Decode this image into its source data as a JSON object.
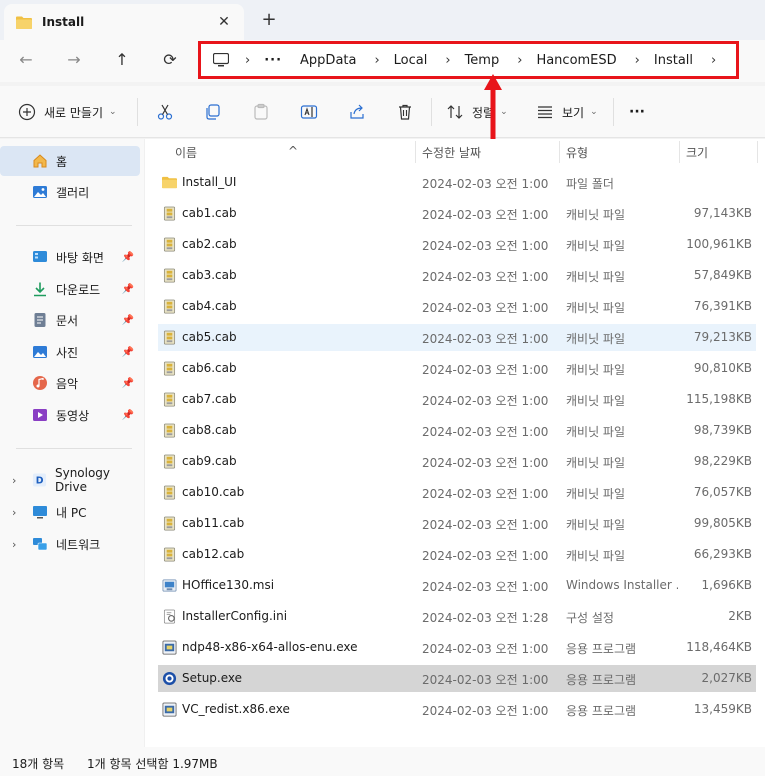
{
  "window": {
    "tab_title": "Install",
    "new_tab": "+",
    "close": "✕"
  },
  "nav": {
    "back": "←",
    "forward": "→",
    "up": "↑",
    "refresh": "⟳"
  },
  "breadcrumb": {
    "overflow": "···",
    "separator": "›",
    "items": [
      "AppData",
      "Local",
      "Temp",
      "HancomESD",
      "Install"
    ]
  },
  "toolbar": {
    "new_label": "새로 만들기",
    "sort_label": "정렬",
    "view_label": "보기",
    "more": "···"
  },
  "sidebar": {
    "home": "홈",
    "gallery": "갤러리",
    "quick": [
      "바탕 화면",
      "다운로드",
      "문서",
      "사진",
      "음악",
      "동영상"
    ],
    "synology": "Synology Drive",
    "this_pc": "내 PC",
    "network": "네트워크"
  },
  "columns": {
    "name": "이름",
    "date": "수정한 날짜",
    "type": "유형",
    "size": "크기"
  },
  "files": [
    {
      "name": "Install_UI",
      "date": "2024-02-03 오전 1:00",
      "type": "파일 폴더",
      "size": "",
      "icon": "folder-icon"
    },
    {
      "name": "cab1.cab",
      "date": "2024-02-03 오전 1:00",
      "type": "캐비닛 파일",
      "size": "97,143KB",
      "icon": "cab-file-icon"
    },
    {
      "name": "cab2.cab",
      "date": "2024-02-03 오전 1:00",
      "type": "캐비닛 파일",
      "size": "100,961KB",
      "icon": "cab-file-icon"
    },
    {
      "name": "cab3.cab",
      "date": "2024-02-03 오전 1:00",
      "type": "캐비닛 파일",
      "size": "57,849KB",
      "icon": "cab-file-icon"
    },
    {
      "name": "cab4.cab",
      "date": "2024-02-03 오전 1:00",
      "type": "캐비닛 파일",
      "size": "76,391KB",
      "icon": "cab-file-icon"
    },
    {
      "name": "cab5.cab",
      "date": "2024-02-03 오전 1:00",
      "type": "캐비닛 파일",
      "size": "79,213KB",
      "icon": "cab-file-icon"
    },
    {
      "name": "cab6.cab",
      "date": "2024-02-03 오전 1:00",
      "type": "캐비닛 파일",
      "size": "90,810KB",
      "icon": "cab-file-icon"
    },
    {
      "name": "cab7.cab",
      "date": "2024-02-03 오전 1:00",
      "type": "캐비닛 파일",
      "size": "115,198KB",
      "icon": "cab-file-icon"
    },
    {
      "name": "cab8.cab",
      "date": "2024-02-03 오전 1:00",
      "type": "캐비닛 파일",
      "size": "98,739KB",
      "icon": "cab-file-icon"
    },
    {
      "name": "cab9.cab",
      "date": "2024-02-03 오전 1:00",
      "type": "캐비닛 파일",
      "size": "98,229KB",
      "icon": "cab-file-icon"
    },
    {
      "name": "cab10.cab",
      "date": "2024-02-03 오전 1:00",
      "type": "캐비닛 파일",
      "size": "76,057KB",
      "icon": "cab-file-icon"
    },
    {
      "name": "cab11.cab",
      "date": "2024-02-03 오전 1:00",
      "type": "캐비닛 파일",
      "size": "99,805KB",
      "icon": "cab-file-icon"
    },
    {
      "name": "cab12.cab",
      "date": "2024-02-03 오전 1:00",
      "type": "캐비닛 파일",
      "size": "66,293KB",
      "icon": "cab-file-icon"
    },
    {
      "name": "HOffice130.msi",
      "date": "2024-02-03 오전 1:00",
      "type": "Windows Installer ...",
      "size": "1,696KB",
      "icon": "msi-file-icon"
    },
    {
      "name": "InstallerConfig.ini",
      "date": "2024-02-03 오전 1:28",
      "type": "구성 설정",
      "size": "2KB",
      "icon": "ini-file-icon"
    },
    {
      "name": "ndp48-x86-x64-allos-enu.exe",
      "date": "2024-02-03 오전 1:00",
      "type": "응용 프로그램",
      "size": "118,464KB",
      "icon": "exe-file-icon"
    },
    {
      "name": "Setup.exe",
      "date": "2024-02-03 오전 1:00",
      "type": "응용 프로그램",
      "size": "2,027KB",
      "icon": "setup-exe-icon"
    },
    {
      "name": "VC_redist.x86.exe",
      "date": "2024-02-03 오전 1:00",
      "type": "응용 프로그램",
      "size": "13,459KB",
      "icon": "exe-file-icon"
    }
  ],
  "status": {
    "count": "18개 항목",
    "selection": "1개 항목 선택함 1.97MB"
  },
  "colors": {
    "annotation": "#e8141a",
    "selected_row": "#d5d5d5",
    "hover_row": "#e9f3fc",
    "nav_active": "#dbe6f4"
  }
}
